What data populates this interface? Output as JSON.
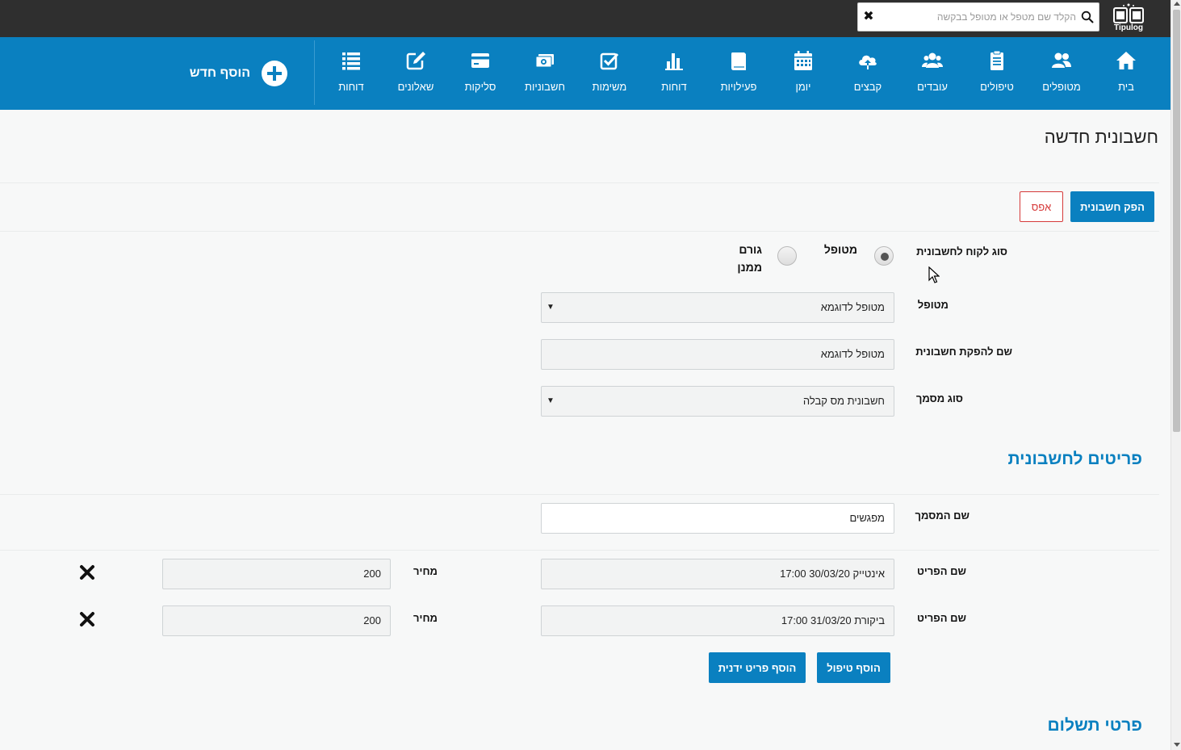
{
  "app": {
    "logo_text": "Tipulog"
  },
  "search": {
    "placeholder": "הקלד שם מטפל או מטופל בבקשה",
    "value": ""
  },
  "nav": {
    "items": [
      {
        "label": "בית",
        "icon": "home-icon"
      },
      {
        "label": "מטופלים",
        "icon": "patients-icon"
      },
      {
        "label": "טיפולים",
        "icon": "clipboard-icon"
      },
      {
        "label": "עובדים",
        "icon": "employees-icon"
      },
      {
        "label": "קבצים",
        "icon": "cloud-upload-icon"
      },
      {
        "label": "יומן",
        "icon": "calendar-icon"
      },
      {
        "label": "פעילויות",
        "icon": "book-icon"
      },
      {
        "label": "דוחות",
        "icon": "bar-chart-icon"
      },
      {
        "label": "משימות",
        "icon": "checkbox-icon"
      },
      {
        "label": "חשבוניות",
        "icon": "money-icon"
      },
      {
        "label": "סליקות",
        "icon": "credit-card-icon"
      },
      {
        "label": "שאלונים",
        "icon": "edit-icon"
      },
      {
        "label": "דוחות",
        "icon": "list-icon"
      }
    ],
    "add_new_label": "הוסף חדש"
  },
  "page": {
    "title": "חשבונית חדשה",
    "issue_button": "הפק חשבונית",
    "reset_button": "אפס"
  },
  "form": {
    "customer_type_label": "סוג לקוח לחשבונית",
    "customer_type_options": [
      {
        "label": "מטופל",
        "selected": true
      },
      {
        "label": "גורם ממנן",
        "selected": false
      }
    ],
    "patient_label": "מטופל",
    "patient_value": "מטופל לדוגמא",
    "invoice_name_label": "שם להפקת חשבונית",
    "invoice_name_value": "מטופל לדוגמא",
    "doc_type_label": "סוג מסמך",
    "doc_type_value": "חשבונית מס קבלה"
  },
  "items_section": {
    "title": "פריטים לחשבונית",
    "doc_name_label": "שם המסמך",
    "doc_name_value": "מפגשים",
    "items": [
      {
        "name_label": "שם הפריט",
        "name_value": "אינטייק 30/03/20 17:00",
        "price_label": "מחיר",
        "price_value": "200"
      },
      {
        "name_label": "שם הפריט",
        "name_value": "ביקורת 31/03/20 17:00",
        "price_label": "מחיר",
        "price_value": "200"
      }
    ],
    "add_treatment_button": "הוסף טיפול",
    "add_manual_item_button": "הוסף פריט ידנית"
  },
  "payment_section": {
    "title": "פרטי תשלום"
  },
  "colors": {
    "brand_blue": "#0a80c0",
    "topbar_dark": "#2f2f2f",
    "danger_red": "#d63a3a"
  }
}
